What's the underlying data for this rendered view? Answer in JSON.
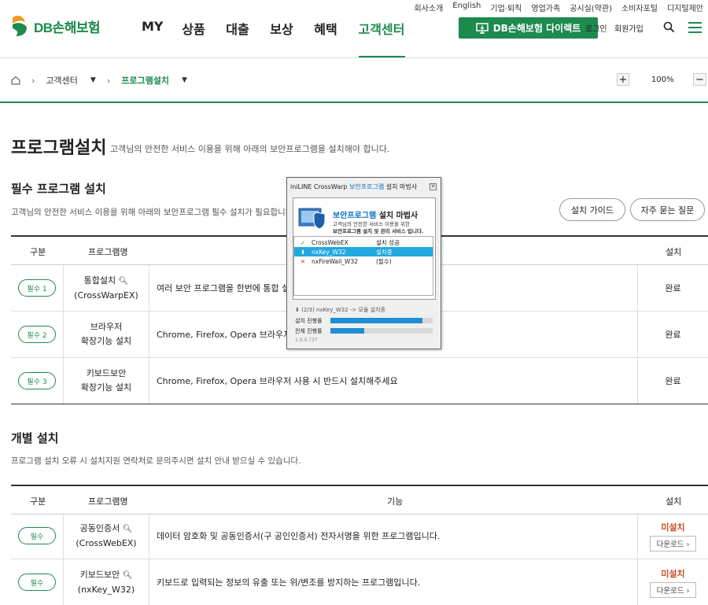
{
  "util": [
    "회사소개",
    "English",
    "기업·퇴직",
    "영업가족",
    "공시실(약관)",
    "소비자포털",
    "디지털제안"
  ],
  "brand": {
    "name": "DB손해보험",
    "color": "#1d8a4e"
  },
  "gnb": [
    "MY",
    "상품",
    "대출",
    "보상",
    "혜택",
    "고객센터"
  ],
  "gnb_active": "고객센터",
  "direct_label": "DB손해보험 다이렉트",
  "login": "로그인",
  "join": "회원가입",
  "breadcrumb": [
    "고객센터",
    "프로그램설치"
  ],
  "zoom": "100%",
  "page": {
    "title": "프로그램설치",
    "subtitle": "고객님의 안전한 서비스 이용을 위해 아래의 보안프로그램을 설치해야 합니다."
  },
  "required": {
    "title": "필수 프로그램 설치",
    "desc": "고객님의 안전한 서비스 이용을 위해 아래의 보안프로그램 필수 설치가 필요합니다.",
    "guide_btn": "설치 가이드",
    "faq_btn": "자주 묻는 질문",
    "headers": [
      "구분",
      "프로그램명",
      "설치"
    ],
    "rows": [
      {
        "badge": "필수 1",
        "name1": "통합설치",
        "name2": "(CrossWarpEX)",
        "desc": "여러 보안 프로그램을 한번에 통합 설치",
        "status": "완료",
        "search": true
      },
      {
        "badge": "필수 2",
        "name1": "브라우저",
        "name2": "확장기능 설치",
        "desc": "Chrome, Firefox, Opera 브라우저 사용",
        "status": "완료",
        "search": false
      },
      {
        "badge": "필수 3",
        "name1": "키보드보안",
        "name2": "확장기능 설치",
        "desc": "Chrome, Firefox, Opera 브라우저 사용 시 반드시 설치해주세요",
        "status": "완료",
        "search": false
      }
    ]
  },
  "individual": {
    "title": "개별 설치",
    "desc": "프로그램 설치 오류 시 설치지원 연락처로 문의주시면 설치 안내 받으실 수 있습니다.",
    "headers": [
      "구분",
      "프로그램명",
      "기능",
      "설치"
    ],
    "rows": [
      {
        "badge": "필수",
        "name1": "공동인증서",
        "name2": "(CrossWebEX)",
        "desc": "데이터 암호화 및 공동인증서(구 공인인증서) 전자서명을 위한 프로그램입니다.",
        "status": "미설치",
        "download": "다운로드"
      },
      {
        "badge": "필수",
        "name1": "키보드보안",
        "name2": "(nxKey_W32)",
        "desc": "키보드로 입력되는 정보의 유출 또는 위/변조를 방지하는 프로그램입니다.",
        "status": "미설치",
        "download": "다운로드"
      }
    ]
  },
  "popup": {
    "title_prefix": "iniLINE CrossWarp",
    "title_hl": "보안프로그램",
    "title_suffix": "설치 마법사",
    "head_hl": "보안프로그램",
    "head_rest": "설치 마법사",
    "sub1": "고객님의 안전한 서비스 이용을 위한",
    "sub2": "보안프로그램 설치 및 관리 서비스 입니다.",
    "items": [
      {
        "icon": "✓",
        "name": "CrossWebEX",
        "status": "설치 성공"
      },
      {
        "icon": "⬇",
        "name": "nxKey_W32",
        "status": "설치중"
      },
      {
        "icon": "✕",
        "name": "nxFireWall_W32",
        "status": "(필수)"
      }
    ],
    "progress_text": "(2/3) nxKey_W32 -> 모듈 설치중",
    "bar1_label": "설치 진행률",
    "bar2_label": "전체 진행률",
    "bar1_pct": 90,
    "bar2_pct": 33,
    "version": "1.0.0.737"
  }
}
